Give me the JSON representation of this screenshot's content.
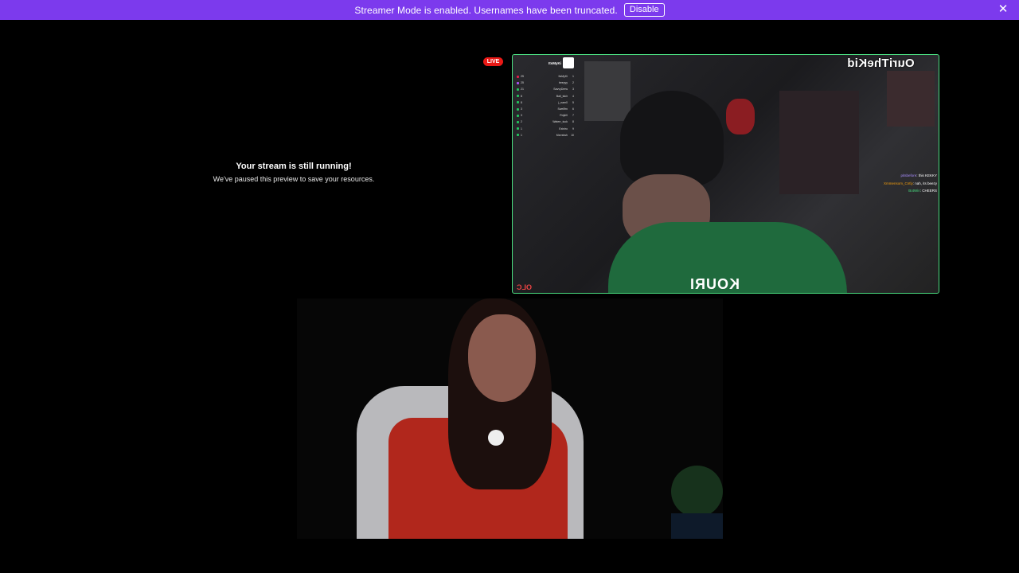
{
  "banner": {
    "message": "Streamer Mode is enabled. Usernames have been truncated.",
    "button_label": "Disable",
    "close_icon": "close-icon",
    "color": "#7c3aed"
  },
  "preview": {
    "title": "Your stream is still running!",
    "subtitle": "We've paused this preview to save your resources."
  },
  "live_badge": {
    "label": "LIVE",
    "color": "#e91916"
  },
  "stream_overlay": {
    "channel_name": "OuriTheKid",
    "logo_text": "KOURI",
    "corner_tag": "OLC",
    "frame_color": "#4ade80",
    "leaderboard": {
      "title": "ItsMyKi",
      "rows": [
        {
          "rank": "1",
          "name": "ItsMyKi",
          "score": "25",
          "color": "#e11d48"
        },
        {
          "rank": "2",
          "name": "beeyyy",
          "score": "25",
          "color": "#a855f7"
        },
        {
          "rank": "3",
          "name": "SavvyDrew",
          "score": "21",
          "color": "#22c55e"
        },
        {
          "rank": "4",
          "name": "Ball_tskir",
          "score": "8",
          "color": "#22c55e"
        },
        {
          "rank": "5",
          "name": "j_nam0",
          "score": "8",
          "color": "#22c55e"
        },
        {
          "rank": "6",
          "name": "Swellfrn",
          "score": "3",
          "color": "#22c55e"
        },
        {
          "rank": "7",
          "name": "Rnjki0",
          "score": "3",
          "color": "#22c55e"
        },
        {
          "rank": "8",
          "name": "Waterr_tuck",
          "score": "2",
          "color": "#22c55e"
        },
        {
          "rank": "9",
          "name": "Exiniro",
          "score": "1",
          "color": "#22c55e"
        },
        {
          "rank": "10",
          "name": "Mxrrstwh",
          "score": "1",
          "color": "#22c55e"
        }
      ]
    },
    "chat": [
      {
        "user": "pitsbefore",
        "message": "this KEKKY",
        "style": ""
      },
      {
        "user": "Xmmensom_Cntly",
        "message": "nah, its beezy",
        "style": "o"
      },
      {
        "user": "BotWin",
        "message": "CHEERS",
        "style": "g"
      }
    ]
  }
}
